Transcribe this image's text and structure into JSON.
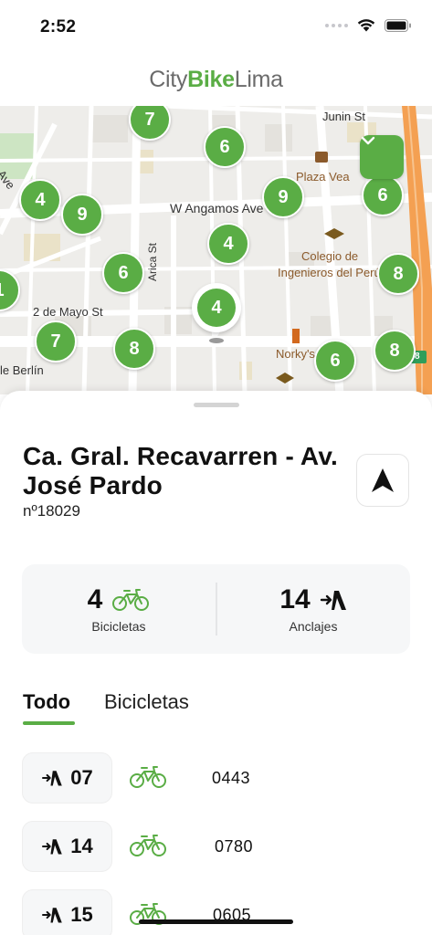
{
  "status_bar": {
    "time": "2:52",
    "icons": [
      "signal-dots-icon",
      "wifi-icon",
      "battery-icon"
    ]
  },
  "header": {
    "brand_part1": "City",
    "brand_part2": "Bike",
    "brand_part3": "Lima"
  },
  "colors": {
    "brand_green": "#5aad45",
    "highway_orange": "#f4a052",
    "map_background": "#eeedea"
  },
  "map": {
    "labels": {
      "junin": "Junin St",
      "plaza_vea": "Plaza Vea",
      "angamos": "W Angamos Ave",
      "colegio_line1": "Colegio de",
      "colegio_line2": "Ingenieros del Perú",
      "arica": "Arica St",
      "dos_de_mayo": "2 de Mayo St",
      "norkys": "Norky's",
      "berlin": "le Berlín",
      "ave_fragment": "s Ave",
      "highway_shield": "8"
    },
    "clusters": [
      "7",
      "6",
      "4",
      "9",
      "9",
      "6",
      "4",
      "6",
      "8",
      "1",
      "7",
      "8",
      "6",
      "8"
    ],
    "selected_station_count": "4"
  },
  "station": {
    "name": "Ca. Gral. Recavarren - Av. José Pardo",
    "number": "nº18029"
  },
  "stats": {
    "bikes_value": "4",
    "bikes_label": "Bicicletas",
    "docks_value": "14",
    "docks_label": "Anclajes"
  },
  "tabs": {
    "all": "Todo",
    "bikes": "Bicicletas",
    "active": "all"
  },
  "docks": [
    {
      "dock": "07",
      "bike_code": "0443"
    },
    {
      "dock": "14",
      "bike_code": "0780"
    },
    {
      "dock": "15",
      "bike_code": "0605"
    }
  ]
}
